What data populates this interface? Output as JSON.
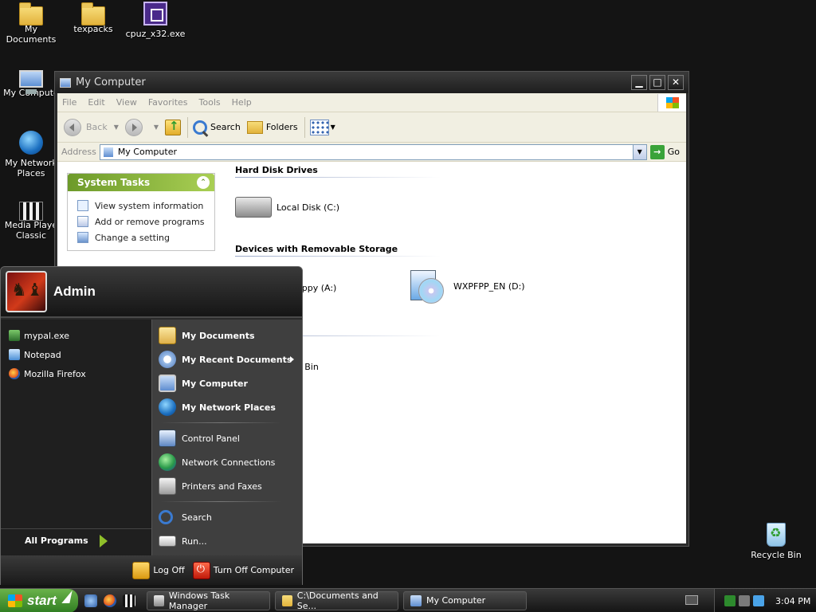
{
  "desktop": {
    "icons": [
      {
        "label": "My Documents"
      },
      {
        "label": "texpacks"
      },
      {
        "label": "cpuz_x32.exe"
      },
      {
        "label": "My Compute"
      },
      {
        "label": "My Network\nPlaces"
      },
      {
        "label": "Media Playe\nClassic"
      },
      {
        "label": "Recycle Bin"
      }
    ]
  },
  "window": {
    "title": "My Computer",
    "menu": [
      "File",
      "Edit",
      "View",
      "Favorites",
      "Tools",
      "Help"
    ],
    "toolbar": {
      "back": "Back",
      "search": "Search",
      "folders": "Folders"
    },
    "address": {
      "label": "Address",
      "value": "My Computer",
      "go": "Go"
    },
    "system_tasks": {
      "title": "System Tasks",
      "items": [
        "View system information",
        "Add or remove programs",
        "Change a setting"
      ]
    },
    "groups": {
      "hdd": "Hard Disk Drives",
      "removable": "Devices with Removable Storage"
    },
    "items": {
      "local_disk": "Local Disk (C:)",
      "floppy": "oppy (A:)",
      "cd": "WXPFPP_EN (D:)",
      "recycle": "e Bin"
    }
  },
  "start_menu": {
    "user": "Admin",
    "pinned": [
      "mypal.exe",
      "Notepad",
      "Mozilla Firefox"
    ],
    "all_programs": "All Programs",
    "right": {
      "my_documents": "My Documents",
      "recent": "My Recent Documents",
      "my_computer": "My Computer",
      "network": "My Network Places",
      "control_panel": "Control Panel",
      "network_connections": "Network Connections",
      "printers": "Printers and Faxes",
      "search": "Search",
      "run": "Run..."
    },
    "log_off": "Log Off",
    "turn_off": "Turn Off Computer"
  },
  "taskbar": {
    "start": "start",
    "buttons": [
      "Windows Task Manager",
      "C:\\Documents and Se...",
      "My Computer"
    ],
    "clock": "3:04 PM"
  }
}
